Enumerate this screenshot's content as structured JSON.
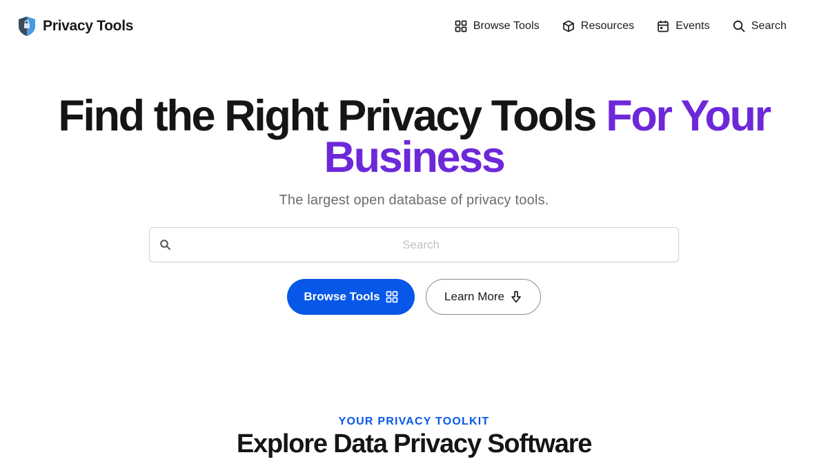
{
  "header": {
    "logo_text": "Privacy Tools",
    "nav": [
      {
        "label": "Browse Tools",
        "icon": "grid-icon"
      },
      {
        "label": "Resources",
        "icon": "box-icon"
      },
      {
        "label": "Events",
        "icon": "calendar-icon"
      },
      {
        "label": "Search",
        "icon": "search-icon"
      }
    ]
  },
  "hero": {
    "title_main": "Find the Right Privacy Tools",
    "title_accent": "For Your Business",
    "subtitle": "The largest open database of privacy tools.",
    "search_placeholder": "Search",
    "search_value": "",
    "primary_button": "Browse Tools",
    "secondary_button": "Learn More"
  },
  "section": {
    "eyebrow": "YOUR PRIVACY TOOLKIT",
    "title": "Explore Data Privacy Software"
  },
  "colors": {
    "accent_purple": "#6d28d9",
    "primary_blue": "#0757e8",
    "text_dark": "#151515",
    "text_muted": "#6b6b6b"
  }
}
